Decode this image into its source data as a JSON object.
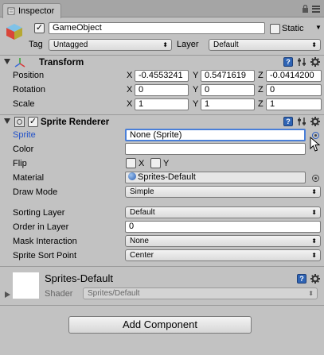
{
  "window": {
    "tab_label": "Inspector"
  },
  "game_object": {
    "name": "GameObject",
    "static_label": "Static",
    "tag_label": "Tag",
    "tag_value": "Untagged",
    "layer_label": "Layer",
    "layer_value": "Default"
  },
  "transform": {
    "title": "Transform",
    "rows": [
      {
        "label": "Position",
        "x": "-0.4553241",
        "y": "0.5471619",
        "z": "-0.0414200"
      },
      {
        "label": "Rotation",
        "x": "0",
        "y": "0",
        "z": "0"
      },
      {
        "label": "Scale",
        "x": "1",
        "y": "1",
        "z": "1"
      }
    ],
    "axes": [
      "X",
      "Y",
      "Z"
    ]
  },
  "sprite_renderer": {
    "title": "Sprite Renderer",
    "sprite_label": "Sprite",
    "sprite_value": "None (Sprite)",
    "color_label": "Color",
    "flip_label": "Flip",
    "flip_x": "X",
    "flip_y": "Y",
    "material_label": "Material",
    "material_value": "Sprites-Default",
    "draw_mode_label": "Draw Mode",
    "draw_mode_value": "Simple",
    "sorting_layer_label": "Sorting Layer",
    "sorting_layer_value": "Default",
    "order_label": "Order in Layer",
    "order_value": "0",
    "mask_label": "Mask Interaction",
    "mask_value": "None",
    "sort_point_label": "Sprite Sort Point",
    "sort_point_value": "Center"
  },
  "material_preview": {
    "name": "Sprites-Default",
    "shader_label": "Shader",
    "shader_value": "Sprites/Default"
  },
  "add_component_label": "Add Component",
  "colors": {
    "accent": "#2f64b4",
    "panel": "#c2c2c2",
    "sprite_label": "#2050c8"
  }
}
